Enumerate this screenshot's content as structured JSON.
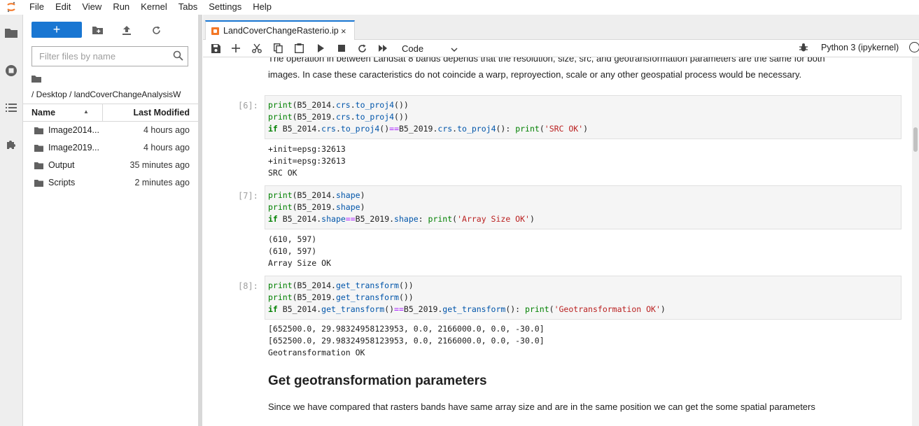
{
  "menubar": {
    "items": [
      "File",
      "Edit",
      "View",
      "Run",
      "Kernel",
      "Tabs",
      "Settings",
      "Help"
    ]
  },
  "filebrowser": {
    "new_label": "+",
    "filter_placeholder": "Filter files by name",
    "path": "/ Desktop / landCoverChangeAnalysisW",
    "col_name": "Name",
    "col_modified": "Last Modified",
    "files": [
      {
        "name": "Image2014...",
        "modified": "4 hours ago"
      },
      {
        "name": "Image2019...",
        "modified": "4 hours ago"
      },
      {
        "name": "Output",
        "modified": "35 minutes ago"
      },
      {
        "name": "Scripts",
        "modified": "2 minutes ago"
      }
    ]
  },
  "tab": {
    "label": "LandCoverChangeRasterio.ip",
    "close": "×"
  },
  "toolbar": {
    "cell_type": "Code",
    "kernel": "Python 3 (ipykernel)"
  },
  "notebook": {
    "md_intro_1": "The operation in between Landsat 8 bands depends that the resolution, size, src, and geotransformation parameters are the same for both",
    "md_intro_2": "images. In case these caracteristics do not coincide a warp, reproyection, scale or any other geospatial process would be necessary.",
    "cells": [
      {
        "prompt": "[6]:",
        "output": [
          "+init=epsg:32613",
          "+init=epsg:32613",
          "SRC OK"
        ]
      },
      {
        "prompt": "[7]:",
        "output": [
          "(610, 597)",
          "(610, 597)",
          "Array Size OK"
        ]
      },
      {
        "prompt": "[8]:",
        "output": [
          "[652500.0, 29.98324958123953, 0.0, 2166000.0, 0.0, -30.0]",
          "[652500.0, 29.98324958123953, 0.0, 2166000.0, 0.0, -30.0]",
          "Geotransformation OK"
        ]
      }
    ],
    "heading": "Get geotransformation parameters",
    "md_outro": "Since we have compared that rasters bands have same array size and are in the same position we can get the some spatial parameters"
  },
  "code": {
    "c6": {
      "l1a": "print",
      "l1b": "(B5_2014.",
      "l1c": "crs",
      "l1d": ".",
      "l1e": "to_proj4",
      "l1f": "())",
      "l2a": "print",
      "l2b": "(B5_2019.",
      "l2c": "crs",
      "l2d": ".",
      "l2e": "to_proj4",
      "l2f": "())",
      "l3a": "if",
      "l3b": " B5_2014.",
      "l3c": "crs",
      "l3d": ".",
      "l3e": "to_proj4",
      "l3f": "()",
      "l3g": "==",
      "l3h": "B5_2019.",
      "l3i": "crs",
      "l3j": ".",
      "l3k": "to_proj4",
      "l3l": "(): ",
      "l3m": "print",
      "l3n": "(",
      "l3o": "'SRC OK'",
      "l3p": ")"
    },
    "c7": {
      "l1a": "print",
      "l1b": "(B5_2014.",
      "l1c": "shape",
      "l1d": ")",
      "l2a": "print",
      "l2b": "(B5_2019.",
      "l2c": "shape",
      "l2d": ")",
      "l3a": "if",
      "l3b": " B5_2014.",
      "l3c": "shape",
      "l3d": "==",
      "l3e": "B5_2019.",
      "l3f": "shape",
      "l3g": ": ",
      "l3h": "print",
      "l3i": "(",
      "l3j": "'Array Size OK'",
      "l3k": ")"
    },
    "c8": {
      "l1a": "print",
      "l1b": "(B5_2014.",
      "l1c": "get_transform",
      "l1d": "())",
      "l2a": "print",
      "l2b": "(B5_2019.",
      "l2c": "get_transform",
      "l2d": "())",
      "l3a": "if",
      "l3b": " B5_2014.",
      "l3c": "get_transform",
      "l3d": "()",
      "l3e": "==",
      "l3f": "B5_2019.",
      "l3g": "get_transform",
      "l3h": "(): ",
      "l3i": "print",
      "l3j": "(",
      "l3k": "'Geotransformation OK'",
      "l3l": ")"
    }
  },
  "colors": {
    "accent": "#1976d2",
    "notebook_icon": "#f37726"
  }
}
